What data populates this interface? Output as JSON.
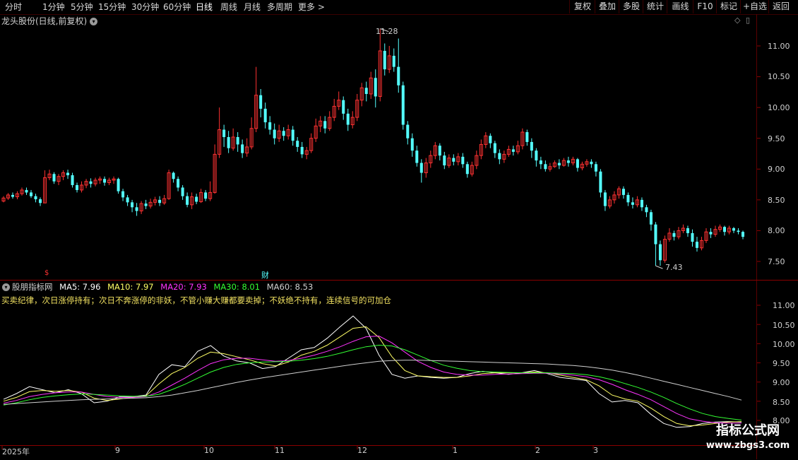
{
  "topbar": {
    "periods": [
      "分时",
      "1分钟",
      "5分钟",
      "15分钟",
      "30分钟",
      "60分钟",
      "日线",
      "周线",
      "月线",
      "多周期",
      "更多 >"
    ],
    "active_period": "日线",
    "buttons": [
      "复权",
      "叠加",
      "多股",
      "统计",
      "画线",
      "F10",
      "标记",
      "+自选",
      "返回"
    ]
  },
  "chart_header": {
    "title": "龙头股份(日线,前复权)"
  },
  "price_axis": [
    "11.00",
    "10.50",
    "10.00",
    "9.50",
    "9.00",
    "8.50",
    "8.00",
    "7.50"
  ],
  "price_annotations": {
    "high": "11.28",
    "low": "7.43"
  },
  "event_marks": {
    "red_mark": "$",
    "cai_mark": "财"
  },
  "indicator": {
    "name": "股朋指标网",
    "ma": [
      {
        "label": "MA5: 7.96",
        "color": "#ffffff"
      },
      {
        "label": "MA10: 7.97",
        "color": "#ffff66"
      },
      {
        "label": "MA20: 7.93",
        "color": "#ff33ff"
      },
      {
        "label": "MA30: 8.01",
        "color": "#33ff33"
      },
      {
        "label": "MA60: 8.53",
        "color": "#d0d0d0"
      }
    ],
    "rule_text": "买卖纪律，次日涨停持有；次日不奔涨停的非妖，不管小赚大赚都要卖掉；不妖绝不持有，连续信号的可加仓",
    "axis": [
      "11.00",
      "10.50",
      "10.00",
      "9.50",
      "9.00",
      "8.50",
      "8.00"
    ]
  },
  "date_axis": [
    "2025年",
    "9",
    "10",
    "11",
    "12",
    "1",
    "2",
    "3"
  ],
  "watermark": {
    "line1": "指标公式网",
    "line2": "www.zbgs3.com"
  },
  "chart_data": {
    "type": "candlestick",
    "title": "龙头股份(日线,前复权)",
    "price_range": [
      7.25,
      11.55
    ],
    "high": 11.28,
    "low": 7.43,
    "colors": {
      "up": "#ff3232",
      "down": "#54ffff"
    },
    "ohlc": [
      [
        8.48,
        8.53,
        8.46,
        8.56
      ],
      [
        8.53,
        8.58,
        8.5,
        8.61
      ],
      [
        8.58,
        8.55,
        8.52,
        8.62
      ],
      [
        8.55,
        8.6,
        8.51,
        8.64
      ],
      [
        8.6,
        8.66,
        8.57,
        8.7
      ],
      [
        8.66,
        8.62,
        8.58,
        8.7
      ],
      [
        8.62,
        8.56,
        8.53,
        8.66
      ],
      [
        8.56,
        8.51,
        8.46,
        8.6
      ],
      [
        8.51,
        8.45,
        8.4,
        8.54
      ],
      [
        8.45,
        8.86,
        8.45,
        8.98
      ],
      [
        8.86,
        8.92,
        8.82,
        8.99
      ],
      [
        8.92,
        8.8,
        8.76,
        8.95
      ],
      [
        8.8,
        8.88,
        8.74,
        8.92
      ],
      [
        8.88,
        8.94,
        8.82,
        8.98
      ],
      [
        8.94,
        8.9,
        8.84,
        8.99
      ],
      [
        8.9,
        8.74,
        8.7,
        8.94
      ],
      [
        8.74,
        8.66,
        8.62,
        8.78
      ],
      [
        8.66,
        8.74,
        8.62,
        8.8
      ],
      [
        8.74,
        8.8,
        8.69,
        8.84
      ],
      [
        8.8,
        8.76,
        8.7,
        8.85
      ],
      [
        8.76,
        8.82,
        8.72,
        8.86
      ],
      [
        8.82,
        8.84,
        8.76,
        8.88
      ],
      [
        8.84,
        8.78,
        8.73,
        8.88
      ],
      [
        8.78,
        8.82,
        8.74,
        8.86
      ],
      [
        8.82,
        8.84,
        8.76,
        8.88
      ],
      [
        8.84,
        8.64,
        8.6,
        8.86
      ],
      [
        8.64,
        8.54,
        8.48,
        8.68
      ],
      [
        8.54,
        8.46,
        8.4,
        8.58
      ],
      [
        8.46,
        8.38,
        8.3,
        8.5
      ],
      [
        8.38,
        8.32,
        8.24,
        8.45
      ],
      [
        8.32,
        8.44,
        8.27,
        8.48
      ],
      [
        8.44,
        8.4,
        8.35,
        8.5
      ],
      [
        8.4,
        8.46,
        8.36,
        8.52
      ],
      [
        8.46,
        8.5,
        8.41,
        8.55
      ],
      [
        8.5,
        8.45,
        8.4,
        8.56
      ],
      [
        8.45,
        8.52,
        8.42,
        8.58
      ],
      [
        8.52,
        8.94,
        8.5,
        8.99
      ],
      [
        8.94,
        8.84,
        8.78,
        8.96
      ],
      [
        8.84,
        8.7,
        8.64,
        8.88
      ],
      [
        8.7,
        8.56,
        8.5,
        8.74
      ],
      [
        8.56,
        8.42,
        8.38,
        8.62
      ],
      [
        8.42,
        8.55,
        8.35,
        8.62
      ],
      [
        8.55,
        8.47,
        8.43,
        8.6
      ],
      [
        8.47,
        8.62,
        8.45,
        8.68
      ],
      [
        8.62,
        8.52,
        8.48,
        8.66
      ],
      [
        8.52,
        8.62,
        8.48,
        8.8
      ],
      [
        8.62,
        9.24,
        8.6,
        9.4
      ],
      [
        9.24,
        9.64,
        9.18,
        10.0
      ],
      [
        9.64,
        9.52,
        9.36,
        9.72
      ],
      [
        9.52,
        9.34,
        9.26,
        9.62
      ],
      [
        9.34,
        9.52,
        9.3,
        9.66
      ],
      [
        9.52,
        9.4,
        9.28,
        9.6
      ],
      [
        9.4,
        9.26,
        9.18,
        9.48
      ],
      [
        9.26,
        9.36,
        9.2,
        9.5
      ],
      [
        9.36,
        9.66,
        9.32,
        9.84
      ],
      [
        9.66,
        10.2,
        9.6,
        10.66
      ],
      [
        10.2,
        9.98,
        9.84,
        10.3
      ],
      [
        9.98,
        9.76,
        9.66,
        10.08
      ],
      [
        9.76,
        9.64,
        9.56,
        9.86
      ],
      [
        9.64,
        9.5,
        9.4,
        9.74
      ],
      [
        9.5,
        9.62,
        9.44,
        9.72
      ],
      [
        9.62,
        9.54,
        9.46,
        9.68
      ],
      [
        9.54,
        9.64,
        9.48,
        9.72
      ],
      [
        9.64,
        9.46,
        9.38,
        9.7
      ],
      [
        9.46,
        9.36,
        9.28,
        9.52
      ],
      [
        9.36,
        9.24,
        9.18,
        9.44
      ],
      [
        9.24,
        9.3,
        9.16,
        9.36
      ],
      [
        9.3,
        9.5,
        9.26,
        9.58
      ],
      [
        9.5,
        9.7,
        9.44,
        9.82
      ],
      [
        9.7,
        9.78,
        9.6,
        9.86
      ],
      [
        9.78,
        9.66,
        9.58,
        9.86
      ],
      [
        9.66,
        9.84,
        9.62,
        9.94
      ],
      [
        9.84,
        10.02,
        9.78,
        10.14
      ],
      [
        10.02,
        10.12,
        9.96,
        10.26
      ],
      [
        10.12,
        9.9,
        9.8,
        10.18
      ],
      [
        9.9,
        9.72,
        9.62,
        9.98
      ],
      [
        9.72,
        9.84,
        9.66,
        9.94
      ],
      [
        9.84,
        10.12,
        9.78,
        10.22
      ],
      [
        10.12,
        10.32,
        10.02,
        10.4
      ],
      [
        10.32,
        10.22,
        10.1,
        10.42
      ],
      [
        10.22,
        10.48,
        10.14,
        10.58
      ],
      [
        10.48,
        10.18,
        10.0,
        10.62
      ],
      [
        10.18,
        10.92,
        10.1,
        11.28
      ],
      [
        10.92,
        10.62,
        10.52,
        11.04
      ],
      [
        10.62,
        10.84,
        10.56,
        11.0
      ],
      [
        10.84,
        10.66,
        10.58,
        10.96
      ],
      [
        10.66,
        10.36,
        10.24,
        11.12
      ],
      [
        10.36,
        9.72,
        9.64,
        10.42
      ],
      [
        9.72,
        9.5,
        9.4,
        9.78
      ],
      [
        9.5,
        9.3,
        9.2,
        9.58
      ],
      [
        9.3,
        9.1,
        9.04,
        9.38
      ],
      [
        9.1,
        8.94,
        8.78,
        9.16
      ],
      [
        8.94,
        9.1,
        8.86,
        9.18
      ],
      [
        9.1,
        9.22,
        9.02,
        9.3
      ],
      [
        9.22,
        9.38,
        9.16,
        9.44
      ],
      [
        9.38,
        9.22,
        9.14,
        9.42
      ],
      [
        9.22,
        9.06,
        9.0,
        9.28
      ],
      [
        9.06,
        9.18,
        9.02,
        9.24
      ],
      [
        9.18,
        9.12,
        9.06,
        9.24
      ],
      [
        9.12,
        9.2,
        9.06,
        9.26
      ],
      [
        9.2,
        9.08,
        9.02,
        9.26
      ],
      [
        9.08,
        8.92,
        8.86,
        9.12
      ],
      [
        8.92,
        9.06,
        8.88,
        9.12
      ],
      [
        9.06,
        9.22,
        9.0,
        9.3
      ],
      [
        9.22,
        9.4,
        9.16,
        9.48
      ],
      [
        9.4,
        9.54,
        9.34,
        9.6
      ],
      [
        9.54,
        9.42,
        9.34,
        9.58
      ],
      [
        9.42,
        9.26,
        9.18,
        9.46
      ],
      [
        9.26,
        9.16,
        9.08,
        9.32
      ],
      [
        9.16,
        9.24,
        9.1,
        9.3
      ],
      [
        9.24,
        9.32,
        9.2,
        9.38
      ],
      [
        9.32,
        9.28,
        9.22,
        9.38
      ],
      [
        9.28,
        9.38,
        9.24,
        9.46
      ],
      [
        9.38,
        9.6,
        9.32,
        9.66
      ],
      [
        9.6,
        9.44,
        9.38,
        9.64
      ],
      [
        9.44,
        9.3,
        9.18,
        9.5
      ],
      [
        9.3,
        9.14,
        9.04,
        9.34
      ],
      [
        9.14,
        9.08,
        9.0,
        9.2
      ],
      [
        9.08,
        9.0,
        8.96,
        9.14
      ],
      [
        9.0,
        9.04,
        8.96,
        9.1
      ],
      [
        9.04,
        9.1,
        9.02,
        9.14
      ],
      [
        9.1,
        9.06,
        9.0,
        9.16
      ],
      [
        9.06,
        9.14,
        9.04,
        9.18
      ],
      [
        9.14,
        9.1,
        9.04,
        9.2
      ],
      [
        9.1,
        9.16,
        9.06,
        9.2
      ],
      [
        9.16,
        9.02,
        8.96,
        9.18
      ],
      [
        9.02,
        9.08,
        8.98,
        9.12
      ],
      [
        9.08,
        9.12,
        9.04,
        9.16
      ],
      [
        9.12,
        9.08,
        9.02,
        9.16
      ],
      [
        9.08,
        8.96,
        8.88,
        9.12
      ],
      [
        8.96,
        8.62,
        8.54,
        9.0
      ],
      [
        8.62,
        8.4,
        8.32,
        8.66
      ],
      [
        8.4,
        8.5,
        8.36,
        8.56
      ],
      [
        8.5,
        8.58,
        8.44,
        8.64
      ],
      [
        8.58,
        8.68,
        8.52,
        8.72
      ],
      [
        8.68,
        8.58,
        8.52,
        8.72
      ],
      [
        8.58,
        8.46,
        8.4,
        8.62
      ],
      [
        8.46,
        8.42,
        8.36,
        8.54
      ],
      [
        8.42,
        8.5,
        8.38,
        8.56
      ],
      [
        8.5,
        8.38,
        8.32,
        8.54
      ],
      [
        8.38,
        8.3,
        8.22,
        8.42
      ],
      [
        8.3,
        8.1,
        8.0,
        8.34
      ],
      [
        8.1,
        7.78,
        7.43,
        8.14
      ],
      [
        7.78,
        7.52,
        7.43,
        7.84
      ],
      [
        7.52,
        7.86,
        7.48,
        7.92
      ],
      [
        7.86,
        7.96,
        7.82,
        8.04
      ],
      [
        7.96,
        7.9,
        7.84,
        8.0
      ],
      [
        7.9,
        8.0,
        7.86,
        8.06
      ],
      [
        8.0,
        8.04,
        7.96,
        8.1
      ],
      [
        8.04,
        7.96,
        7.9,
        8.08
      ],
      [
        7.96,
        7.82,
        7.74,
        8.02
      ],
      [
        7.82,
        7.72,
        7.66,
        7.9
      ],
      [
        7.72,
        7.84,
        7.68,
        7.9
      ],
      [
        7.84,
        7.98,
        7.8,
        8.04
      ],
      [
        7.98,
        7.94,
        7.88,
        8.04
      ],
      [
        7.94,
        8.02,
        7.9,
        8.08
      ],
      [
        8.02,
        8.06,
        7.98,
        8.1
      ],
      [
        8.06,
        7.98,
        7.92,
        8.08
      ],
      [
        7.98,
        8.04,
        7.94,
        8.08
      ],
      [
        8.04,
        8.0,
        7.96,
        8.06
      ],
      [
        8.0,
        7.98,
        7.94,
        8.04
      ],
      [
        7.98,
        7.9,
        7.86,
        8.0
      ]
    ],
    "indicator_range": [
      7.85,
      11.45
    ],
    "ma_series": [
      {
        "name": "MA5",
        "color": "#ffffff",
        "points": [
          8.55,
          8.7,
          8.88,
          8.8,
          8.72,
          8.8,
          8.7,
          8.46,
          8.5,
          8.62,
          8.62,
          8.66,
          9.2,
          9.45,
          9.4,
          9.8,
          9.95,
          9.68,
          9.55,
          9.5,
          9.35,
          9.4,
          9.62,
          9.84,
          9.9,
          10.14,
          10.44,
          10.72,
          10.4,
          9.7,
          9.2,
          9.1,
          9.16,
          9.12,
          9.1,
          9.12,
          9.22,
          9.28,
          9.24,
          9.2,
          9.24,
          9.3,
          9.22,
          9.12,
          9.08,
          9.04,
          8.7,
          8.48,
          8.52,
          8.46,
          8.16,
          7.92,
          7.82,
          7.84,
          7.92,
          7.96,
          7.97,
          7.96
        ]
      },
      {
        "name": "MA10",
        "color": "#ffff66",
        "points": [
          8.5,
          8.6,
          8.75,
          8.78,
          8.76,
          8.78,
          8.74,
          8.58,
          8.52,
          8.56,
          8.6,
          8.64,
          8.95,
          9.22,
          9.38,
          9.62,
          9.78,
          9.74,
          9.66,
          9.58,
          9.48,
          9.42,
          9.52,
          9.7,
          9.8,
          9.96,
          10.18,
          10.4,
          10.44,
          10.16,
          9.66,
          9.3,
          9.16,
          9.14,
          9.12,
          9.12,
          9.16,
          9.22,
          9.24,
          9.24,
          9.24,
          9.26,
          9.24,
          9.18,
          9.12,
          9.06,
          8.9,
          8.66,
          8.56,
          8.5,
          8.32,
          8.1,
          7.92,
          7.86,
          7.88,
          7.92,
          7.96,
          7.97
        ]
      },
      {
        "name": "MA20",
        "color": "#ff33ff",
        "points": [
          8.45,
          8.52,
          8.62,
          8.68,
          8.72,
          8.74,
          8.74,
          8.68,
          8.62,
          8.6,
          8.6,
          8.62,
          8.74,
          8.92,
          9.1,
          9.3,
          9.48,
          9.58,
          9.62,
          9.62,
          9.58,
          9.54,
          9.56,
          9.62,
          9.7,
          9.8,
          9.92,
          10.06,
          10.18,
          10.2,
          10.02,
          9.78,
          9.54,
          9.38,
          9.26,
          9.2,
          9.18,
          9.18,
          9.2,
          9.21,
          9.22,
          9.23,
          9.23,
          9.21,
          9.18,
          9.14,
          9.06,
          8.94,
          8.8,
          8.68,
          8.54,
          8.36,
          8.18,
          8.04,
          7.98,
          7.94,
          7.93,
          7.93
        ]
      },
      {
        "name": "MA30",
        "color": "#33ff33",
        "points": [
          8.4,
          8.46,
          8.54,
          8.6,
          8.64,
          8.67,
          8.69,
          8.68,
          8.66,
          8.64,
          8.63,
          8.63,
          8.68,
          8.8,
          8.94,
          9.1,
          9.26,
          9.38,
          9.46,
          9.5,
          9.52,
          9.53,
          9.54,
          9.57,
          9.61,
          9.67,
          9.75,
          9.84,
          9.92,
          9.96,
          9.94,
          9.84,
          9.7,
          9.56,
          9.44,
          9.36,
          9.3,
          9.27,
          9.26,
          9.25,
          9.24,
          9.24,
          9.24,
          9.23,
          9.22,
          9.19,
          9.14,
          9.06,
          8.96,
          8.86,
          8.74,
          8.6,
          8.44,
          8.3,
          8.18,
          8.1,
          8.05,
          8.01
        ]
      },
      {
        "name": "MA60",
        "color": "#d0d0d0",
        "points": [
          8.42,
          8.44,
          8.46,
          8.48,
          8.5,
          8.52,
          8.54,
          8.55,
          8.56,
          8.57,
          8.58,
          8.59,
          8.62,
          8.66,
          8.72,
          8.78,
          8.85,
          8.92,
          8.99,
          9.05,
          9.11,
          9.16,
          9.21,
          9.26,
          9.31,
          9.36,
          9.41,
          9.46,
          9.5,
          9.54,
          9.56,
          9.57,
          9.57,
          9.56,
          9.55,
          9.54,
          9.53,
          9.52,
          9.51,
          9.5,
          9.49,
          9.48,
          9.47,
          9.45,
          9.43,
          9.4,
          9.36,
          9.31,
          9.25,
          9.18,
          9.1,
          9.02,
          8.94,
          8.86,
          8.78,
          8.7,
          8.62,
          8.53
        ]
      }
    ]
  }
}
